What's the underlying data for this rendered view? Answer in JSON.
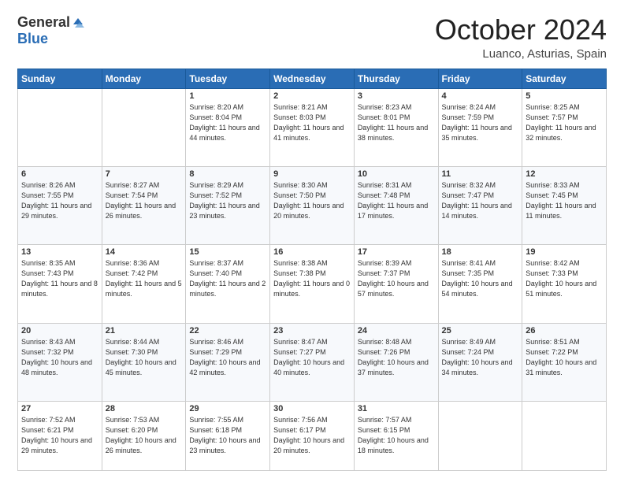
{
  "logo": {
    "general": "General",
    "blue": "Blue"
  },
  "header": {
    "month": "October 2024",
    "location": "Luanco, Asturias, Spain"
  },
  "days_of_week": [
    "Sunday",
    "Monday",
    "Tuesday",
    "Wednesday",
    "Thursday",
    "Friday",
    "Saturday"
  ],
  "weeks": [
    [
      {
        "day": "",
        "empty": true
      },
      {
        "day": "",
        "empty": true
      },
      {
        "day": "1",
        "sunrise": "8:20 AM",
        "sunset": "8:04 PM",
        "daylight": "11 hours and 44 minutes."
      },
      {
        "day": "2",
        "sunrise": "8:21 AM",
        "sunset": "8:03 PM",
        "daylight": "11 hours and 41 minutes."
      },
      {
        "day": "3",
        "sunrise": "8:23 AM",
        "sunset": "8:01 PM",
        "daylight": "11 hours and 38 minutes."
      },
      {
        "day": "4",
        "sunrise": "8:24 AM",
        "sunset": "7:59 PM",
        "daylight": "11 hours and 35 minutes."
      },
      {
        "day": "5",
        "sunrise": "8:25 AM",
        "sunset": "7:57 PM",
        "daylight": "11 hours and 32 minutes."
      }
    ],
    [
      {
        "day": "6",
        "sunrise": "8:26 AM",
        "sunset": "7:55 PM",
        "daylight": "11 hours and 29 minutes."
      },
      {
        "day": "7",
        "sunrise": "8:27 AM",
        "sunset": "7:54 PM",
        "daylight": "11 hours and 26 minutes."
      },
      {
        "day": "8",
        "sunrise": "8:29 AM",
        "sunset": "7:52 PM",
        "daylight": "11 hours and 23 minutes."
      },
      {
        "day": "9",
        "sunrise": "8:30 AM",
        "sunset": "7:50 PM",
        "daylight": "11 hours and 20 minutes."
      },
      {
        "day": "10",
        "sunrise": "8:31 AM",
        "sunset": "7:48 PM",
        "daylight": "11 hours and 17 minutes."
      },
      {
        "day": "11",
        "sunrise": "8:32 AM",
        "sunset": "7:47 PM",
        "daylight": "11 hours and 14 minutes."
      },
      {
        "day": "12",
        "sunrise": "8:33 AM",
        "sunset": "7:45 PM",
        "daylight": "11 hours and 11 minutes."
      }
    ],
    [
      {
        "day": "13",
        "sunrise": "8:35 AM",
        "sunset": "7:43 PM",
        "daylight": "11 hours and 8 minutes."
      },
      {
        "day": "14",
        "sunrise": "8:36 AM",
        "sunset": "7:42 PM",
        "daylight": "11 hours and 5 minutes."
      },
      {
        "day": "15",
        "sunrise": "8:37 AM",
        "sunset": "7:40 PM",
        "daylight": "11 hours and 2 minutes."
      },
      {
        "day": "16",
        "sunrise": "8:38 AM",
        "sunset": "7:38 PM",
        "daylight": "11 hours and 0 minutes."
      },
      {
        "day": "17",
        "sunrise": "8:39 AM",
        "sunset": "7:37 PM",
        "daylight": "10 hours and 57 minutes."
      },
      {
        "day": "18",
        "sunrise": "8:41 AM",
        "sunset": "7:35 PM",
        "daylight": "10 hours and 54 minutes."
      },
      {
        "day": "19",
        "sunrise": "8:42 AM",
        "sunset": "7:33 PM",
        "daylight": "10 hours and 51 minutes."
      }
    ],
    [
      {
        "day": "20",
        "sunrise": "8:43 AM",
        "sunset": "7:32 PM",
        "daylight": "10 hours and 48 minutes."
      },
      {
        "day": "21",
        "sunrise": "8:44 AM",
        "sunset": "7:30 PM",
        "daylight": "10 hours and 45 minutes."
      },
      {
        "day": "22",
        "sunrise": "8:46 AM",
        "sunset": "7:29 PM",
        "daylight": "10 hours and 42 minutes."
      },
      {
        "day": "23",
        "sunrise": "8:47 AM",
        "sunset": "7:27 PM",
        "daylight": "10 hours and 40 minutes."
      },
      {
        "day": "24",
        "sunrise": "8:48 AM",
        "sunset": "7:26 PM",
        "daylight": "10 hours and 37 minutes."
      },
      {
        "day": "25",
        "sunrise": "8:49 AM",
        "sunset": "7:24 PM",
        "daylight": "10 hours and 34 minutes."
      },
      {
        "day": "26",
        "sunrise": "8:51 AM",
        "sunset": "7:22 PM",
        "daylight": "10 hours and 31 minutes."
      }
    ],
    [
      {
        "day": "27",
        "sunrise": "7:52 AM",
        "sunset": "6:21 PM",
        "daylight": "10 hours and 29 minutes."
      },
      {
        "day": "28",
        "sunrise": "7:53 AM",
        "sunset": "6:20 PM",
        "daylight": "10 hours and 26 minutes."
      },
      {
        "day": "29",
        "sunrise": "7:55 AM",
        "sunset": "6:18 PM",
        "daylight": "10 hours and 23 minutes."
      },
      {
        "day": "30",
        "sunrise": "7:56 AM",
        "sunset": "6:17 PM",
        "daylight": "10 hours and 20 minutes."
      },
      {
        "day": "31",
        "sunrise": "7:57 AM",
        "sunset": "6:15 PM",
        "daylight": "10 hours and 18 minutes."
      },
      {
        "day": "",
        "empty": true
      },
      {
        "day": "",
        "empty": true
      }
    ]
  ]
}
